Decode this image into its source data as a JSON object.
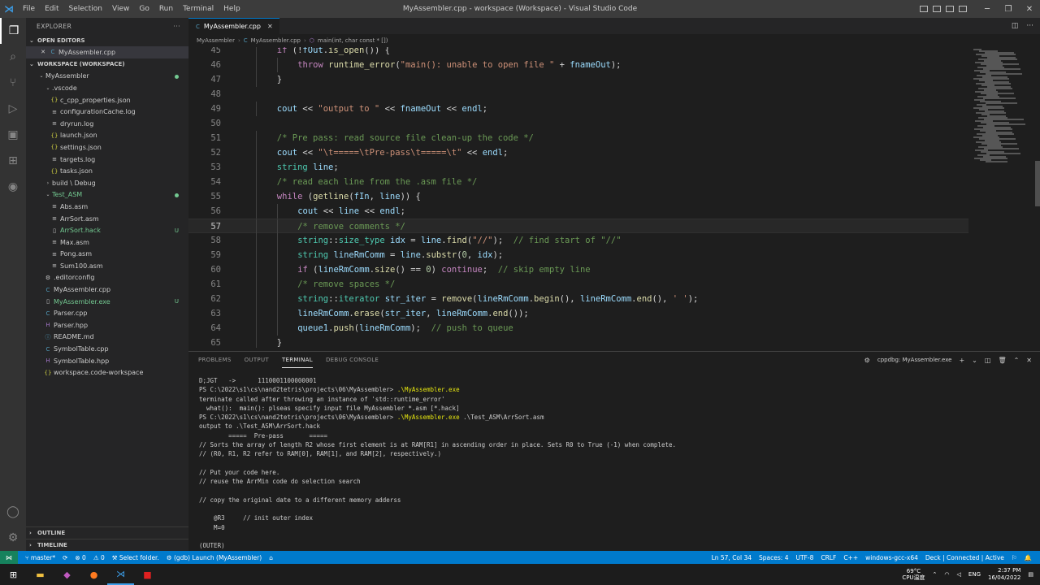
{
  "titlebar": {
    "menu": [
      "File",
      "Edit",
      "Selection",
      "View",
      "Go",
      "Run",
      "Terminal",
      "Help"
    ],
    "title": "MyAssembler.cpp - workspace (Workspace) - Visual Studio Code"
  },
  "sidebar": {
    "header": "EXPLORER",
    "open_editors": "OPEN EDITORS",
    "open_file": "MyAssembler.cpp",
    "workspace": "WORKSPACE (WORKSPACE)",
    "tree": [
      {
        "label": "MyAssembler",
        "indent": 0,
        "type": "folder-open",
        "dot": true
      },
      {
        "label": ".vscode",
        "indent": 1,
        "type": "folder-open"
      },
      {
        "label": "c_cpp_properties.json",
        "indent": 2,
        "type": "json"
      },
      {
        "label": "configurationCache.log",
        "indent": 2,
        "type": "log"
      },
      {
        "label": "dryrun.log",
        "indent": 2,
        "type": "log"
      },
      {
        "label": "launch.json",
        "indent": 2,
        "type": "json"
      },
      {
        "label": "settings.json",
        "indent": 2,
        "type": "json"
      },
      {
        "label": "targets.log",
        "indent": 2,
        "type": "log"
      },
      {
        "label": "tasks.json",
        "indent": 2,
        "type": "json"
      },
      {
        "label": "build \\ Debug",
        "indent": 1,
        "type": "folder"
      },
      {
        "label": "Test_ASM",
        "indent": 1,
        "type": "folder-open",
        "green": true,
        "dot": true
      },
      {
        "label": "Abs.asm",
        "indent": 2,
        "type": "asm"
      },
      {
        "label": "ArrSort.asm",
        "indent": 2,
        "type": "asm"
      },
      {
        "label": "ArrSort.hack",
        "indent": 2,
        "type": "file",
        "green": true,
        "badge": "U"
      },
      {
        "label": "Max.asm",
        "indent": 2,
        "type": "asm"
      },
      {
        "label": "Pong.asm",
        "indent": 2,
        "type": "asm"
      },
      {
        "label": "Sum100.asm",
        "indent": 2,
        "type": "asm"
      },
      {
        "label": ".editorconfig",
        "indent": 1,
        "type": "cfg"
      },
      {
        "label": "MyAssembler.cpp",
        "indent": 1,
        "type": "cpp"
      },
      {
        "label": "MyAssembler.exe",
        "indent": 1,
        "type": "file",
        "green": true,
        "badge": "U"
      },
      {
        "label": "Parser.cpp",
        "indent": 1,
        "type": "cpp"
      },
      {
        "label": "Parser.hpp",
        "indent": 1,
        "type": "hpp"
      },
      {
        "label": "README.md",
        "indent": 1,
        "type": "md"
      },
      {
        "label": "SymbolTable.cpp",
        "indent": 1,
        "type": "cpp"
      },
      {
        "label": "SymbolTable.hpp",
        "indent": 1,
        "type": "hpp"
      },
      {
        "label": "workspace.code-workspace",
        "indent": 1,
        "type": "json"
      }
    ],
    "outline": "OUTLINE",
    "timeline": "TIMELINE"
  },
  "tab": {
    "label": "MyAssembler.cpp",
    "close": "✕"
  },
  "breadcrumb": [
    "MyAssembler",
    "MyAssembler.cpp",
    "main(int, char const * [])"
  ],
  "code": {
    "current_line": 57,
    "lines": [
      {
        "n": 45,
        "indent": 2,
        "t": [
          [
            "kw",
            "if"
          ],
          [
            "op",
            " (!"
          ],
          [
            "vr",
            "fOut"
          ],
          [
            "op",
            "."
          ],
          [
            "fn",
            "is_open"
          ],
          [
            "op",
            "()) {"
          ]
        ]
      },
      {
        "n": 46,
        "indent": 3,
        "t": [
          [
            "kw",
            "throw"
          ],
          [
            "op",
            " "
          ],
          [
            "fn",
            "runtime_error"
          ],
          [
            "op",
            "("
          ],
          [
            "st",
            "\"main(): unable to open file \""
          ],
          [
            "op",
            " + "
          ],
          [
            "vr",
            "fnameOut"
          ],
          [
            "op",
            ");"
          ]
        ]
      },
      {
        "n": 47,
        "indent": 2,
        "t": [
          [
            "op",
            "}"
          ]
        ]
      },
      {
        "n": 48,
        "indent": 0,
        "t": []
      },
      {
        "n": 49,
        "indent": 2,
        "t": [
          [
            "vr",
            "cout"
          ],
          [
            "op",
            " << "
          ],
          [
            "st",
            "\"output to \""
          ],
          [
            "op",
            " << "
          ],
          [
            "vr",
            "fnameOut"
          ],
          [
            "op",
            " << "
          ],
          [
            "vr",
            "endl"
          ],
          [
            "op",
            ";"
          ]
        ]
      },
      {
        "n": 50,
        "indent": 0,
        "t": []
      },
      {
        "n": 51,
        "indent": 2,
        "t": [
          [
            "cm",
            "/* Pre pass: read source file clean-up the code */"
          ]
        ]
      },
      {
        "n": 52,
        "indent": 2,
        "t": [
          [
            "vr",
            "cout"
          ],
          [
            "op",
            " << "
          ],
          [
            "st",
            "\"\\t=====\\tPre-pass\\t=====\\t\""
          ],
          [
            "op",
            " << "
          ],
          [
            "vr",
            "endl"
          ],
          [
            "op",
            ";"
          ]
        ]
      },
      {
        "n": 53,
        "indent": 2,
        "t": [
          [
            "ty",
            "string"
          ],
          [
            "op",
            " "
          ],
          [
            "vr",
            "line"
          ],
          [
            "op",
            ";"
          ]
        ]
      },
      {
        "n": 54,
        "indent": 2,
        "t": [
          [
            "cm",
            "/* read each line from the .asm file */"
          ]
        ]
      },
      {
        "n": 55,
        "indent": 2,
        "t": [
          [
            "kw",
            "while"
          ],
          [
            "op",
            " ("
          ],
          [
            "fn",
            "getline"
          ],
          [
            "op",
            "("
          ],
          [
            "vr",
            "fIn"
          ],
          [
            "op",
            ", "
          ],
          [
            "vr",
            "line"
          ],
          [
            "op",
            ")) {"
          ]
        ]
      },
      {
        "n": 56,
        "indent": 3,
        "t": [
          [
            "vr",
            "cout"
          ],
          [
            "op",
            " << "
          ],
          [
            "vr",
            "line"
          ],
          [
            "op",
            " << "
          ],
          [
            "vr",
            "endl"
          ],
          [
            "op",
            ";"
          ]
        ]
      },
      {
        "n": 57,
        "indent": 3,
        "t": [
          [
            "cm",
            "/* remove comments */"
          ]
        ]
      },
      {
        "n": 58,
        "indent": 3,
        "t": [
          [
            "ty",
            "string"
          ],
          [
            "op",
            "::"
          ],
          [
            "ty",
            "size_type"
          ],
          [
            "op",
            " "
          ],
          [
            "vr",
            "idx"
          ],
          [
            "op",
            " = "
          ],
          [
            "vr",
            "line"
          ],
          [
            "op",
            "."
          ],
          [
            "fn",
            "find"
          ],
          [
            "op",
            "("
          ],
          [
            "st",
            "\"//\""
          ],
          [
            "op",
            ");  "
          ],
          [
            "cm",
            "// find start of \"//\""
          ]
        ]
      },
      {
        "n": 59,
        "indent": 3,
        "t": [
          [
            "ty",
            "string"
          ],
          [
            "op",
            " "
          ],
          [
            "vr",
            "lineRmComm"
          ],
          [
            "op",
            " = "
          ],
          [
            "vr",
            "line"
          ],
          [
            "op",
            "."
          ],
          [
            "fn",
            "substr"
          ],
          [
            "op",
            "("
          ],
          [
            "nm",
            "0"
          ],
          [
            "op",
            ", "
          ],
          [
            "vr",
            "idx"
          ],
          [
            "op",
            ");"
          ]
        ]
      },
      {
        "n": 60,
        "indent": 3,
        "t": [
          [
            "kw",
            "if"
          ],
          [
            "op",
            " ("
          ],
          [
            "vr",
            "lineRmComm"
          ],
          [
            "op",
            "."
          ],
          [
            "fn",
            "size"
          ],
          [
            "op",
            "() == "
          ],
          [
            "nm",
            "0"
          ],
          [
            "op",
            ") "
          ],
          [
            "kw",
            "continue"
          ],
          [
            "op",
            ";  "
          ],
          [
            "cm",
            "// skip empty line"
          ]
        ]
      },
      {
        "n": 61,
        "indent": 3,
        "t": [
          [
            "cm",
            "/* remove spaces */"
          ]
        ]
      },
      {
        "n": 62,
        "indent": 3,
        "t": [
          [
            "ty",
            "string"
          ],
          [
            "op",
            "::"
          ],
          [
            "ty",
            "iterator"
          ],
          [
            "op",
            " "
          ],
          [
            "vr",
            "str_iter"
          ],
          [
            "op",
            " = "
          ],
          [
            "fn",
            "remove"
          ],
          [
            "op",
            "("
          ],
          [
            "vr",
            "lineRmComm"
          ],
          [
            "op",
            "."
          ],
          [
            "fn",
            "begin"
          ],
          [
            "op",
            "(), "
          ],
          [
            "vr",
            "lineRmComm"
          ],
          [
            "op",
            "."
          ],
          [
            "fn",
            "end"
          ],
          [
            "op",
            "(), "
          ],
          [
            "st",
            "' '"
          ],
          [
            "op",
            ");"
          ]
        ]
      },
      {
        "n": 63,
        "indent": 3,
        "t": [
          [
            "vr",
            "lineRmComm"
          ],
          [
            "op",
            "."
          ],
          [
            "fn",
            "erase"
          ],
          [
            "op",
            "("
          ],
          [
            "vr",
            "str_iter"
          ],
          [
            "op",
            ", "
          ],
          [
            "vr",
            "lineRmComm"
          ],
          [
            "op",
            "."
          ],
          [
            "fn",
            "end"
          ],
          [
            "op",
            "());"
          ]
        ]
      },
      {
        "n": 64,
        "indent": 3,
        "t": [
          [
            "vr",
            "queue1"
          ],
          [
            "op",
            "."
          ],
          [
            "fn",
            "push"
          ],
          [
            "op",
            "("
          ],
          [
            "vr",
            "lineRmComm"
          ],
          [
            "op",
            ");  "
          ],
          [
            "cm",
            "// push to queue"
          ]
        ]
      },
      {
        "n": 65,
        "indent": 2,
        "t": [
          [
            "op",
            "}"
          ]
        ]
      }
    ]
  },
  "panel": {
    "tabs": [
      "PROBLEMS",
      "OUTPUT",
      "TERMINAL",
      "DEBUG CONSOLE"
    ],
    "active_tab": "TERMINAL",
    "terminal_name": "cppdbg: MyAssembler.exe",
    "terminal_lines": [
      "D;JGT   ->      1110001100000001",
      "PS C:\\2022\\s1\\cs\\nand2tetris\\projects\\06\\MyAssembler> .\\MyAssembler.exe",
      "terminate called after throwing an instance of 'std::runtime_error'",
      "  what():  main(): plseas specify input file MyAssembler *.asm [*.hack]",
      "PS C:\\2022\\s1\\cs\\nand2tetris\\projects\\06\\MyAssembler> .\\MyAssembler.exe .\\Test_ASM\\ArrSort.asm",
      "output to .\\Test_ASM\\ArrSort.hack",
      "        =====  Pre-pass       =====",
      "// Sorts the array of length R2 whose first element is at RAM[R1] in ascending order in place. Sets R0 to True (-1) when complete.",
      "// (R0, R1, R2 refer to RAM[0], RAM[1], and RAM[2], respectively.)",
      "",
      "// Put your code here.",
      "// reuse the ArrMin code do selection search",
      "",
      "// copy the original date to a different memory adderss",
      "",
      "    @R3     // init outer index",
      "    M=0",
      "",
      "(OUTER)"
    ]
  },
  "statusbar": {
    "branch": "master*",
    "sync": "⟳",
    "errors": "⊗ 0",
    "warnings": "⚠ 0",
    "select_folder": "Select folder.",
    "launch": "(gdb) Launch (MyAssembler)",
    "position": "Ln 57, Col 34",
    "spaces": "Spaces: 4",
    "encoding": "UTF-8",
    "eol": "CRLF",
    "language": "C++",
    "compiler": "windows-gcc-x64",
    "deck": "Deck | Connected | Active"
  },
  "taskbar": {
    "temp": "69°C",
    "cpu": "CPU温度",
    "lang": "ENG",
    "time": "2:37 PM",
    "date": "16/04/2022"
  },
  "colors": {
    "accent": "#007acc",
    "statusbar": "#007acc",
    "modified_green": "#73c991"
  }
}
